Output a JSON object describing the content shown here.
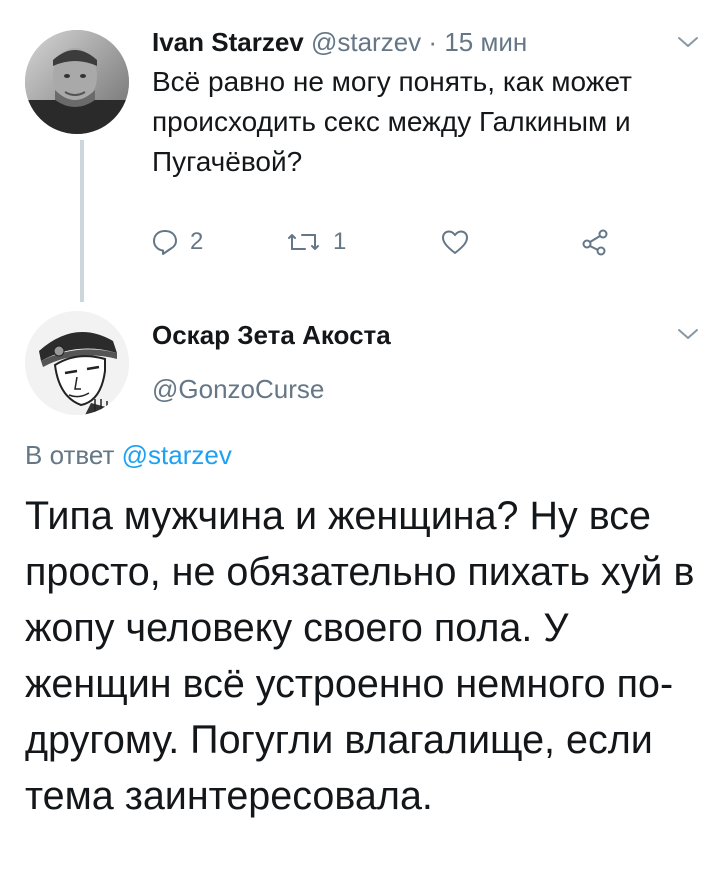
{
  "tweet1": {
    "author_name": "Ivan Starzev",
    "author_handle": "@starzev",
    "separator": "·",
    "time": "15 мин",
    "text": "Всё равно не могу понять, как может происходить секс между Галкиным и Пугачёвой?",
    "reply_count": "2",
    "retweet_count": "1",
    "avatar_icon": "profile-photo-man"
  },
  "tweet2": {
    "author_name": "Оскар Зета Акоста",
    "author_handle": "@GonzoCurse",
    "reply_prefix": "В ответ",
    "reply_handle": "@starzev",
    "text": "Типа мужчина и женщина? Ну все просто, не обязательно пихать хуй в жопу человеку своего пола. У женщин всё устроенно немного по-другому. Погугли влагалище, если тема заинтересовала.",
    "avatar_icon": "illustrated-man-in-cap"
  },
  "icons": {
    "reply": "reply-icon",
    "retweet": "retweet-icon",
    "like": "heart-icon",
    "share": "share-icon",
    "more": "chevron-down-icon"
  },
  "colors": {
    "text": "#14171a",
    "muted": "#657786",
    "link": "#1da1f2",
    "thread_line": "#ccd6dd"
  }
}
